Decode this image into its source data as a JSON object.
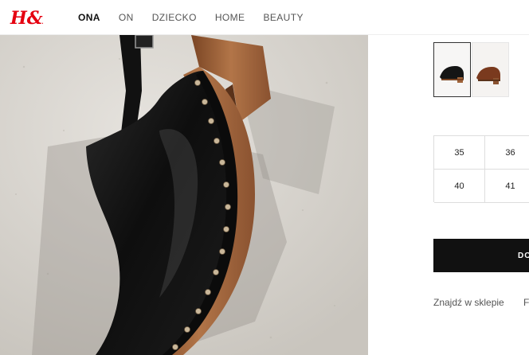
{
  "header": {
    "logo_text": "H&M",
    "nav": [
      {
        "label": "ONA",
        "active": true
      },
      {
        "label": "ON",
        "active": false
      },
      {
        "label": "DZIECKO",
        "active": false
      },
      {
        "label": "HOME",
        "active": false
      },
      {
        "label": "BEAUTY",
        "active": false
      }
    ]
  },
  "product": {
    "image_icon": "studded-clog-photo",
    "colors": [
      {
        "name": "black",
        "swatch": "#1a1a1a",
        "selected": true
      },
      {
        "name": "brown",
        "swatch": "#7a3a1e",
        "selected": false
      }
    ]
  },
  "sizes": [
    "35",
    "36",
    "40",
    "41"
  ],
  "actions": {
    "add_label": "DO",
    "find_store_label": "Znajdź w sklepie",
    "secondary_label": "F"
  },
  "colors": {
    "brand": "#e50010",
    "button_bg": "#111111",
    "leather": "#151515",
    "wood": "#a0643a"
  }
}
